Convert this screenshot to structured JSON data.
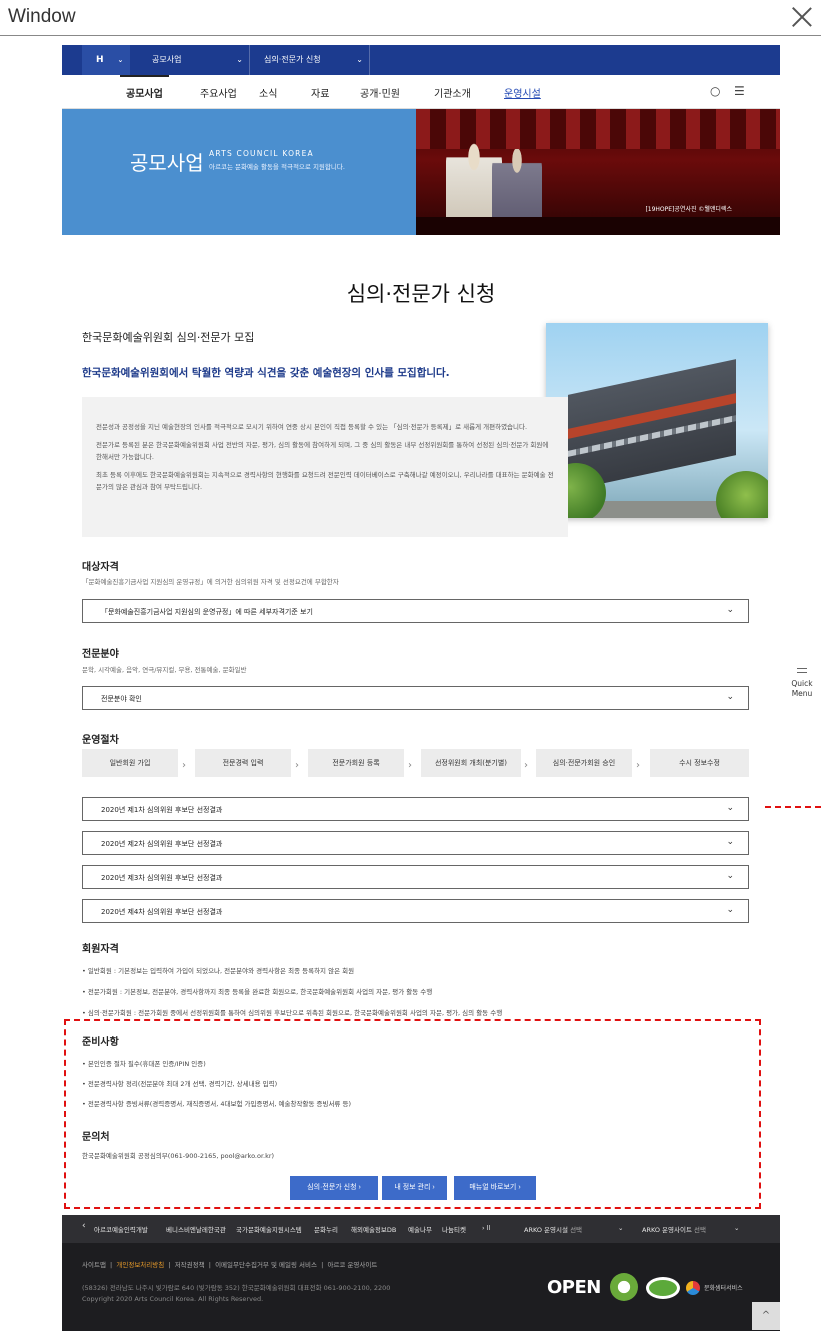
{
  "window": {
    "title": "Window"
  },
  "topbar": {
    "home": "H",
    "menu1": "공모사업",
    "menu2": "심의·전문가 신청"
  },
  "gnb": {
    "items": [
      "공모사업",
      "주요사업",
      "소식",
      "자료",
      "공개·민원",
      "기관소개",
      "운영시설"
    ]
  },
  "banner": {
    "title": "공모사업",
    "en": "ARTS COUNCIL KOREA",
    "sub": "아르코는 문화예술 활동을 적극적으로 지원합니다.",
    "caption": "[19HOPE]공연사진 ©웰앤디렉스"
  },
  "page": {
    "title": "심의·전문가 신청",
    "recruit_title": "한국문화예술위원회 심의·전문가 모집",
    "recruit_lead": "한국문화예술위원회에서 탁월한 역량과 식견을 갖춘 예술현장의 인사를 모집합니다.",
    "intro": [
      "전문성과 공정성을 지닌 예술현장의 인사를 적극적으로 모시기 위하여 연중 상시 본인이 직접 등록할 수 있는 「심의·전문가 등록제」로 새롭게 개편하였습니다.",
      "전문가로 등록된 분은 한국문화예술위원회 사업 전반의 자문, 평가, 심의 활동에 참여하게 되며, 그 중 심의 활동은 내부 선정위원회를 통하여 선정된 심의·전문가 회원에 한해서만 가능합니다.",
      "최초 등록 이후에도 한국문화예술위원회는 지속적으로 경력사항의 현행화를 요청드려 전문인력 데이터베이스로 구축해나갈 예정이오니, 우리나라를 대표하는 문화예술 전문가의 많은 관심과 참여 부탁드립니다."
    ]
  },
  "qualification": {
    "heading": "대상자격",
    "sub": "「문화예술진흥기금사업 지원심의 운영규정」에 의거한 심의위원 자격 및 선정요건에 부합한자",
    "accordion": "「문화예술진흥기금사업 지원심의 운영규정」에 따른 세부자격기준 보기"
  },
  "fields": {
    "heading": "전문분야",
    "sub": "문학, 시각예술, 음악, 연극/뮤지컬, 무용, 전통예술, 문화일반",
    "accordion": "전문분야 확인"
  },
  "procedure": {
    "heading": "운영절차",
    "steps": [
      "일반회원 가입",
      "전문경력 입력",
      "전문가회원 등록",
      "선정위원회 개최(분기별)",
      "심의·전문가회원 승인",
      "수시 정보수정"
    ],
    "results": [
      "2020년 제1차 심의위원 후보단 선정결과",
      "2020년 제2차 심의위원 후보단 선정결과",
      "2020년 제3차 심의위원 후보단 선정결과",
      "2020년 제4차 심의위원 후보단 선정결과"
    ]
  },
  "membership": {
    "heading": "회원자격",
    "items": [
      "일반회원 : 기본정보는 입력하여 가입이 되었으나, 전문분야와 경력사항은 최종 등록하지 않은 회원",
      "전문가회원 : 기본정보, 전문분야, 경력사항까지 최종 등록을 완료한 회원으로, 한국문화예술위원회 사업의 자문, 평가 활동 수행",
      "심의·전문가회원 : 전문가회원 중에서 선정위원회를 통하여 심의위원 후보단으로 위촉된 회원으로, 한국문화예술위원회 사업의 자문, 평가, 심의 활동 수행"
    ]
  },
  "prepare": {
    "heading": "준비사항",
    "items": [
      "본인인증 절차 필수(휴대폰 인증/IPIN 인증)",
      "전문경력사항 정리(전문분야 최대 2개 선택, 경력기간, 상세내용 입력)",
      "전문경력사항 증빙서류(경력증명서, 재직증명서, 4대보험 가입증명서, 예술창작활동 증빙서류 등)"
    ]
  },
  "contact": {
    "heading": "문의처",
    "text": "한국문화예술위원회 공정심의부(061-900-2165, pool@arko.or.kr)"
  },
  "buttons": {
    "apply": "심의·전문가 신청  ›",
    "myinfo": "내 정보 관리  ›",
    "manual": "매뉴얼 바로보기  ›"
  },
  "footer_nav": {
    "links": [
      "아르코예술인력개발",
      "베니스비엔날레한국관",
      "국가문화예술지원시스템",
      "문화누리",
      "해외예술정보DB",
      "예술나무",
      "나눔티켓"
    ],
    "prev": "‹",
    "controls": "›   ll",
    "facility": "ARKO 운영시설",
    "facility_sel": "선택",
    "site": "ARKO 운영사이트",
    "site_sel": "선택"
  },
  "footer": {
    "links": [
      "사이트맵",
      "개인정보처리방침",
      "저작권정책",
      "이메일무단수집거부 및 메일링 서비스",
      "아르코 운영사이트"
    ],
    "addr": "(58326) 전라남도 나주시 빛가람로 640 (빛가람동 352) 한국문화예술위원회 대표전화 061-900-2100, 2200",
    "copy": "Copyright 2020 Arts Council Korea. All Rights Reserved.",
    "open": "OPEN",
    "logo_text": "문화셈터서비스"
  },
  "quick": {
    "label1": "Quick",
    "label2": "Menu"
  }
}
